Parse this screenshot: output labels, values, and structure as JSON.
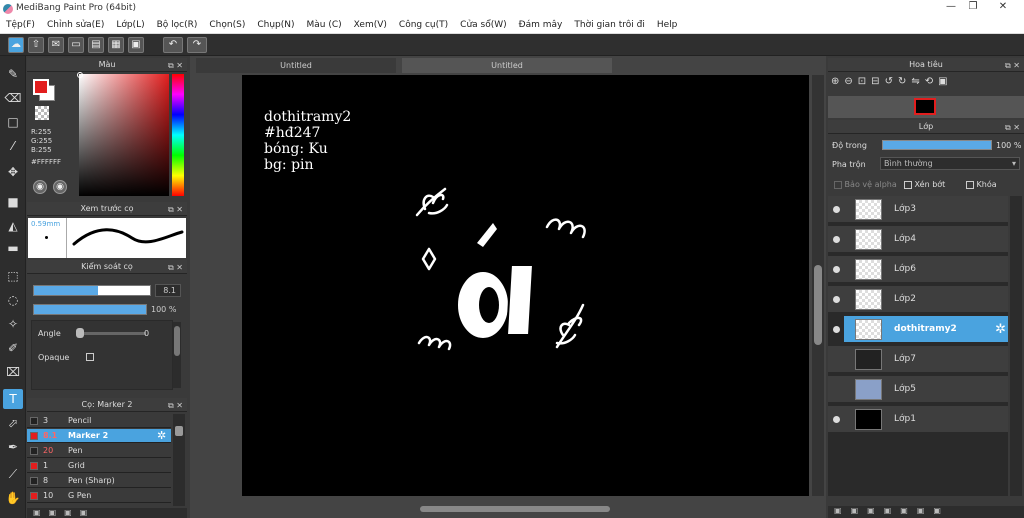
{
  "window": {
    "title": "MediBang Paint Pro (64bit)"
  },
  "menu": [
    "Tệp(F)",
    "Chỉnh sửa(E)",
    "Lớp(L)",
    "Bộ lọc(R)",
    "Chọn(S)",
    "Chụp(N)",
    "Màu (C)",
    "Xem(V)",
    "Công cụ(T)",
    "Cửa sổ(W)",
    "Đám mây",
    "Thời gian trôi đi",
    "Help"
  ],
  "color_panel": {
    "title": "Màu",
    "r": "R:255",
    "g": "G:255",
    "b": "B:255",
    "hex": "#FFFFFF"
  },
  "preview_panel": {
    "title": "Xem trước cọ",
    "size": "0.59mm"
  },
  "control_panel": {
    "title": "Kiểm soát cọ",
    "size_value": "8.1",
    "opacity_value": "100 %",
    "size_fraction": 0.55,
    "opacity_fraction": 1.0,
    "angle_label": "Angle",
    "angle_value": "0",
    "opaque_label": "Opaque"
  },
  "brush_panel": {
    "title": "Cọ: Marker 2",
    "items": [
      {
        "size": "3",
        "name": "Pencil",
        "color": "#222222"
      },
      {
        "size": "8.1",
        "name": "Marker 2",
        "color": "#e21e1e"
      },
      {
        "size": "20",
        "name": "Pen",
        "color": "#222222"
      },
      {
        "size": "1",
        "name": "Grid",
        "color": "#e21e1e"
      },
      {
        "size": "8",
        "name": "Pen (Sharp)",
        "color": "#222222"
      },
      {
        "size": "10",
        "name": "G Pen",
        "color": "#e21e1e"
      }
    ]
  },
  "tabs": [
    "Untitled",
    "Untitled"
  ],
  "canvas_text": [
    "dothitramy2",
    "#hđ247",
    "bóng: Ku",
    "bg: pin"
  ],
  "navigator_panel": {
    "title": "Hoa tiêu"
  },
  "layer_panel": {
    "title": "Lớp",
    "opacity_label": "Độ trong",
    "opacity_value": "100 %",
    "blend_label": "Pha trộn",
    "blend_value": "Bình thường",
    "protect_alpha": "Bảo vệ alpha",
    "clip": "Xén bớt",
    "lock": "Khóa",
    "layers": [
      "Lớp3",
      "Lớp4",
      "Lớp6",
      "Lớp2",
      "dothitramy2",
      "Lớp7",
      "Lớp5",
      "Lớp1"
    ]
  },
  "colors": {
    "accent": "#4aa3df",
    "primary": "#e21e1e",
    "canvas": "#000000"
  }
}
